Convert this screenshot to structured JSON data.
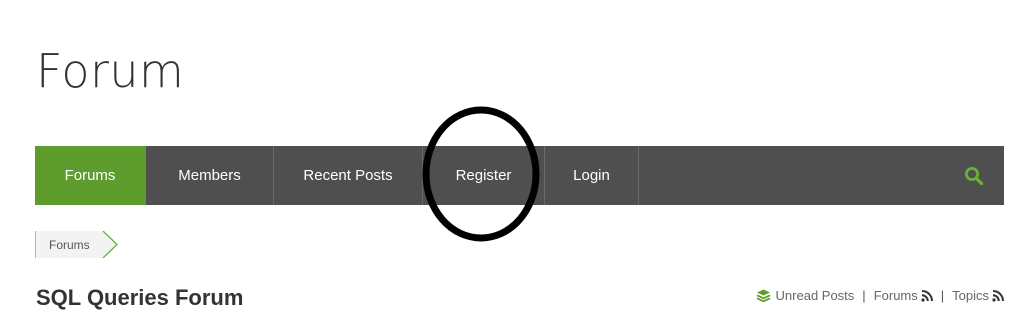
{
  "page": {
    "title": "Forum"
  },
  "navbar": {
    "items": [
      {
        "label": "Forums",
        "active": true
      },
      {
        "label": "Members"
      },
      {
        "label": "Recent Posts"
      },
      {
        "label": "Register"
      },
      {
        "label": "Login"
      }
    ],
    "search_icon": "search-icon",
    "active_color": "#5e9c2e",
    "bar_color": "#4f4f4f"
  },
  "breadcrumb": {
    "items": [
      {
        "label": "Forums"
      }
    ]
  },
  "forum": {
    "title": "SQL Queries Forum",
    "links": {
      "unread": "Unread Posts",
      "forums": "Forums",
      "topics": "Topics",
      "separator": "|"
    }
  },
  "colors": {
    "accent": "#5e9c2e"
  }
}
